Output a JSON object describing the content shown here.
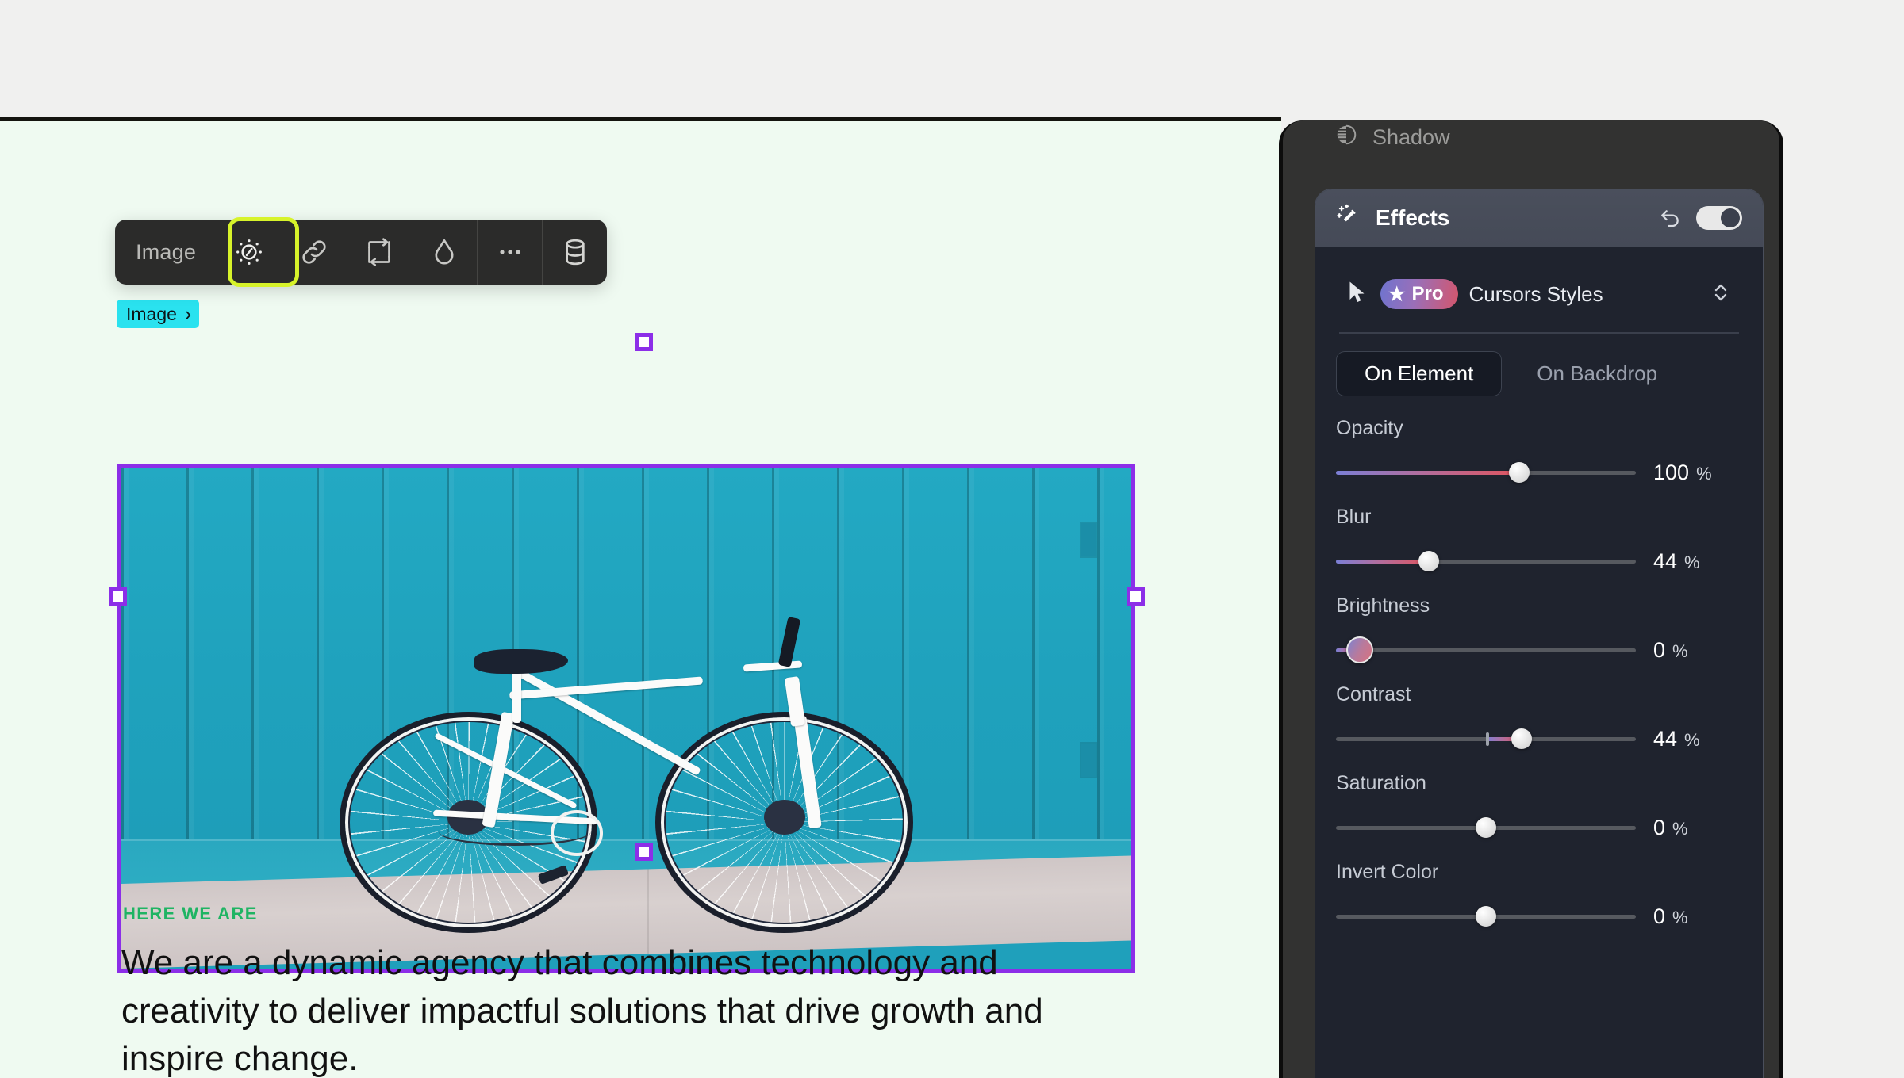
{
  "canvas": {
    "element_tag": "Image",
    "tag_chevron": "›",
    "eyebrow": "HERE WE ARE",
    "headline": "We are a dynamic agency that combines technology and creativity to deliver impactful solutions that drive growth and inspire change.",
    "accent_green": "#1fb463",
    "tag_cyan": "#2ae2ef",
    "selection_purple": "#8c2ee8",
    "background": "#effaf1"
  },
  "toolbar": {
    "label": "Image",
    "highlight_color": "#d7f32a",
    "buttons": [
      {
        "name": "brightness-icon",
        "title": "Adjust"
      },
      {
        "name": "link-icon",
        "title": "Link"
      },
      {
        "name": "replace-icon",
        "title": "Replace"
      },
      {
        "name": "droplet-icon",
        "title": "Color"
      },
      {
        "name": "more-icon",
        "title": "More"
      },
      {
        "name": "database-icon",
        "title": "Data"
      }
    ]
  },
  "panel": {
    "shadow_item": "Shadow",
    "effects": {
      "title": "Effects",
      "reset_icon": "undo-icon",
      "toggle_on": true,
      "cursor_row": {
        "badge": "Pro",
        "badge_star": "★",
        "label": "Cursors Styles",
        "chevron": "chevron-updown-icon"
      },
      "tabs": [
        {
          "label": "On Element",
          "active": true
        },
        {
          "label": "On Backdrop",
          "active": false
        }
      ],
      "sliders": [
        {
          "label": "Opacity",
          "value": "100",
          "unit": "%",
          "pct": 61,
          "style": "gradient"
        },
        {
          "label": "Blur",
          "value": "44",
          "unit": "%",
          "pct": 31,
          "style": "gradient"
        },
        {
          "label": "Brightness",
          "value": "0",
          "unit": "%",
          "pct": 8,
          "style": "gradient-big"
        },
        {
          "label": "Contrast",
          "value": "44",
          "unit": "%",
          "pct": 62,
          "style": "center-tick"
        },
        {
          "label": "Saturation",
          "value": "0",
          "unit": "%",
          "pct": 50,
          "style": "plain"
        },
        {
          "label": "Invert Color",
          "value": "0",
          "unit": "%",
          "pct": 50,
          "style": "plain"
        }
      ]
    }
  }
}
